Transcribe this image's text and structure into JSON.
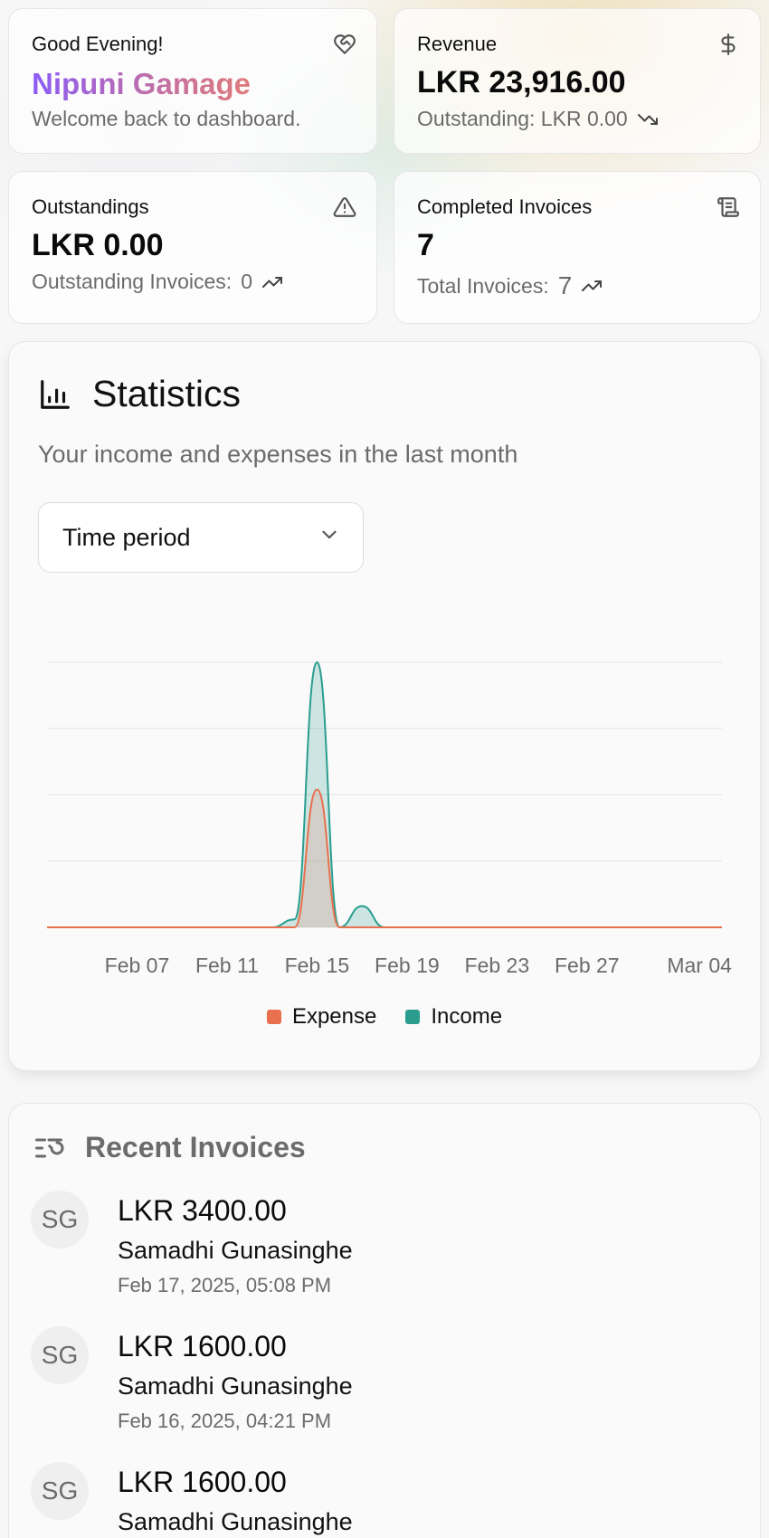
{
  "greeting": {
    "title": "Good Evening!",
    "name": "Nipuni Gamage",
    "subtitle": "Welcome back to dashboard.",
    "icon": "heart-handshake-icon"
  },
  "revenue": {
    "title": "Revenue",
    "value": "LKR 23,916.00",
    "sub": "Outstanding: LKR 0.00",
    "icon": "dollar-icon",
    "trend": "trending-down-icon"
  },
  "outstandings": {
    "title": "Outstandings",
    "value": "LKR 0.00",
    "sub_label": "Outstanding Invoices:",
    "sub_value": "0",
    "icon": "alert-triangle-icon",
    "trend": "trending-up-icon"
  },
  "completed": {
    "title": "Completed Invoices",
    "value": "7",
    "sub_label": "Total Invoices:",
    "sub_value": "7",
    "icon": "scroll-icon",
    "trend": "trending-up-icon"
  },
  "statistics": {
    "title": "Statistics",
    "subtitle": "Your income and expenses in the last month",
    "select_label": "Time period",
    "icon": "bar-chart-icon"
  },
  "chart_data": {
    "type": "area",
    "x": [
      "Feb 03",
      "Feb 04",
      "Feb 05",
      "Feb 06",
      "Feb 07",
      "Feb 08",
      "Feb 09",
      "Feb 10",
      "Feb 11",
      "Feb 12",
      "Feb 13",
      "Feb 14",
      "Feb 15",
      "Feb 16",
      "Feb 17",
      "Feb 18",
      "Feb 19",
      "Feb 20",
      "Feb 21",
      "Feb 22",
      "Feb 23",
      "Feb 24",
      "Feb 25",
      "Feb 26",
      "Feb 27",
      "Feb 28",
      "Mar 01",
      "Mar 02",
      "Mar 03",
      "Mar 04",
      "Mar 05"
    ],
    "x_ticks": [
      "Feb 07",
      "Feb 11",
      "Feb 15",
      "Feb 19",
      "Feb 23",
      "Feb 27",
      "Mar 04"
    ],
    "series": [
      {
        "name": "Expense",
        "color": "#e8704e",
        "values": [
          0,
          0,
          0,
          0,
          0,
          0,
          0,
          0,
          0,
          0,
          0,
          0,
          10400,
          0,
          0,
          0,
          0,
          0,
          0,
          0,
          0,
          0,
          0,
          0,
          0,
          0,
          0,
          0,
          0,
          0,
          0
        ]
      },
      {
        "name": "Income",
        "color": "#2a9d8f",
        "values": [
          0,
          0,
          0,
          0,
          0,
          0,
          0,
          0,
          0,
          0,
          0,
          600,
          20000,
          0,
          1600,
          0,
          0,
          0,
          0,
          0,
          0,
          0,
          0,
          0,
          0,
          0,
          0,
          0,
          0,
          0,
          0
        ]
      }
    ],
    "ylim": [
      0,
      20000
    ],
    "grid": true,
    "legend": "bottom"
  },
  "recent_invoices": {
    "title": "Recent Invoices",
    "icon": "list-history-icon",
    "items": [
      {
        "initials": "SG",
        "amount": "LKR 3400.00",
        "name": "Samadhi Gunasinghe",
        "date": "Feb 17, 2025, 05:08 PM"
      },
      {
        "initials": "SG",
        "amount": "LKR 1600.00",
        "name": "Samadhi Gunasinghe",
        "date": "Feb 16, 2025, 04:21 PM"
      },
      {
        "initials": "SG",
        "amount": "LKR 1600.00",
        "name": "Samadhi Gunasinghe",
        "date": ""
      }
    ]
  }
}
